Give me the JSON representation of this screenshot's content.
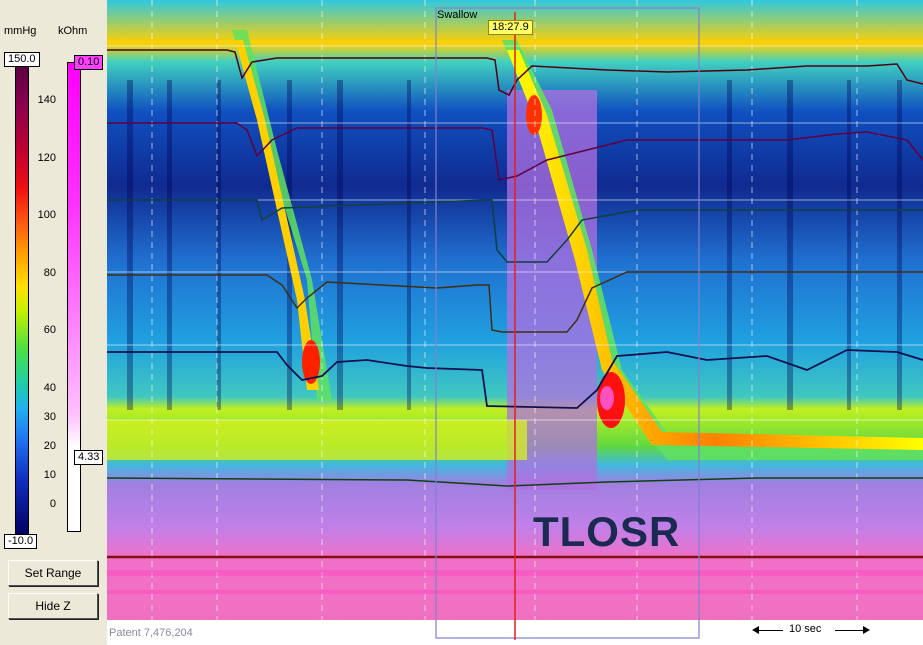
{
  "units": {
    "pressure": "mmHg",
    "impedance": "kOhm"
  },
  "pressure_scale": {
    "max_label": "150.0",
    "min_label": "-10.0",
    "ticks": [
      "140",
      "120",
      "100",
      "80",
      "60",
      "40",
      "30",
      "20",
      "10",
      "0"
    ]
  },
  "impedance_scale": {
    "top_label": "0.10",
    "marker_label": "4.33"
  },
  "buttons": {
    "set_range": "Set Range",
    "hide_z": "Hide Z"
  },
  "plot": {
    "swallow_label": "Swallow",
    "cursor_time": "18:27.9",
    "annotation": "TLOSR",
    "patent": "Patent 7,476,204",
    "time_scale": "10 sec"
  },
  "colors": {
    "cursor": "#e02020",
    "window_box": "#8080d0",
    "badge": "#ffff66"
  }
}
